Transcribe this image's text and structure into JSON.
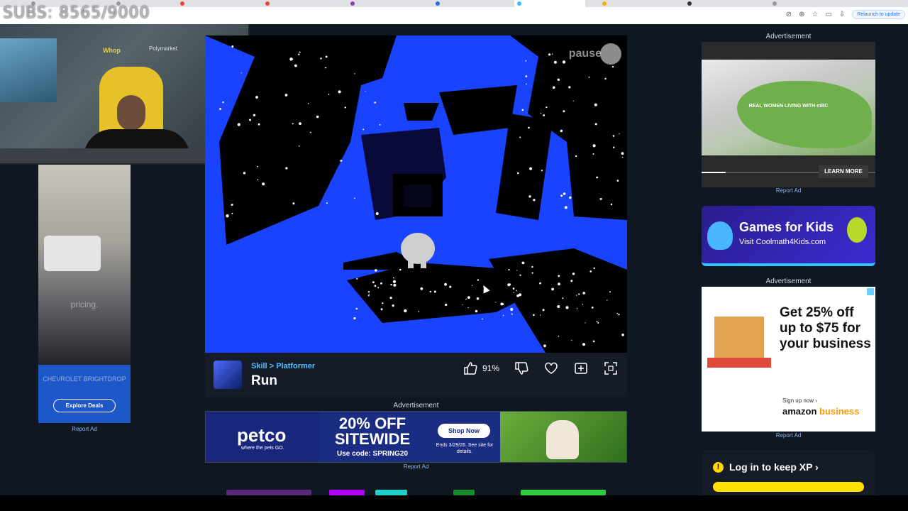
{
  "browser": {
    "tabs": [
      "",
      "",
      "",
      "",
      "",
      "",
      "",
      "",
      "",
      "",
      ""
    ],
    "relaunch_label": "Relaunch to update"
  },
  "overlay": {
    "subs_text": "SUBS: 8565/9000"
  },
  "webcam": {
    "wall_logo_text": "Whop",
    "poly_text": "Polymarket"
  },
  "left_ad": {
    "pricing_text": "pricing.",
    "brand_text": "CHEVROLET BRIGHTDROP",
    "cta_label": "Explore Deals",
    "report_label": "Report Ad"
  },
  "game": {
    "pause_label": "pause",
    "breadcrumb_category": "Skill",
    "breadcrumb_separator": ">",
    "breadcrumb_subcategory": "Platformer",
    "title": "Run",
    "rating_percent": "91%"
  },
  "center_ad": {
    "label": "Advertisement",
    "logo_text": "petco",
    "tagline": "where the pets GO.",
    "offer_line1": "20% OFF",
    "offer_line2": "SITEWIDE",
    "code_text": "Use code: SPRING20",
    "shop_label": "Shop Now",
    "ends_text": "Ends 3/29/26. See site for details.",
    "report_label": "Report Ad"
  },
  "right_ads": {
    "top_label": "Advertisement",
    "video_caption": "REAL WOMEN LIVING WITH mBC",
    "learn_more_label": "LEARN MORE",
    "video_progress": 0.14,
    "report_label_1": "Report Ad",
    "kids_title": "Games for Kids",
    "kids_sub": "Visit Coolmath4Kids.com",
    "middle_label": "Advertisement",
    "amazon_headline": "Get 25% off up to $75 for your business",
    "amazon_signup": "Sign up now ›",
    "amazon_brand_a": "amazon",
    "amazon_brand_b": "business",
    "report_label_2": "Report Ad"
  },
  "xp": {
    "warn_icon": "!",
    "login_text": "Log in to keep XP ›"
  },
  "colors": {
    "game_blue": "#1a43ff",
    "page_bg": "#0f1722",
    "accent_cyan": "#4fc0ff",
    "xp_yellow": "#ffe000"
  }
}
